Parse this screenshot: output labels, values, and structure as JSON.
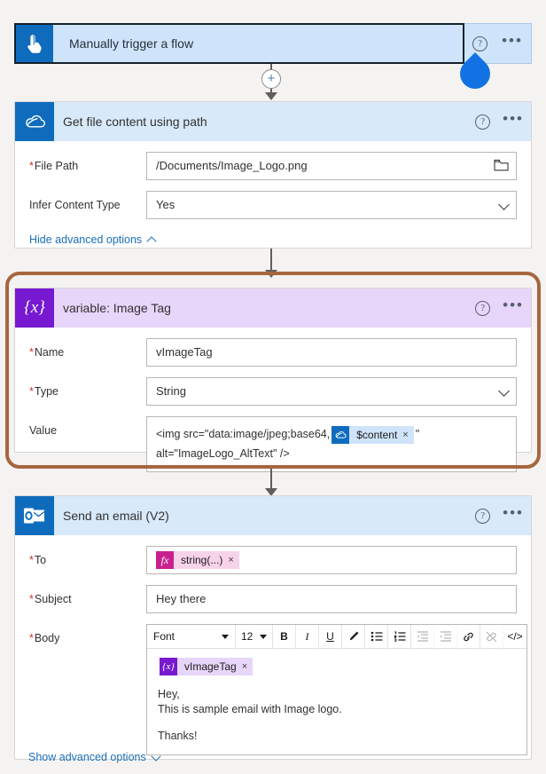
{
  "background_color": "#f4f3f2",
  "accent_color": "#0f6cbd",
  "highlight_border_color": "#a8653f",
  "cursor_color": "#1272e4",
  "trigger": {
    "icon": "tap-hand-icon",
    "title": "Manually trigger a flow",
    "help_label": "?",
    "menu_label": "•••"
  },
  "connector": {
    "plus_label": "+"
  },
  "get_file": {
    "icon": "onedrive-cloud-icon",
    "title": "Get file content using path",
    "help_label": "?",
    "menu_label": "•••",
    "fields": [
      {
        "label": "File Path",
        "required": true,
        "value": "/Documents/Image_Logo.png",
        "control": "textbox-with-folder-picker"
      },
      {
        "label": "Infer Content Type",
        "required": false,
        "value": "Yes",
        "control": "dropdown"
      }
    ],
    "advanced_link": "Hide advanced options"
  },
  "variable": {
    "icon": "variable-braces-icon",
    "icon_glyph": "{x}",
    "title": "variable: Image Tag",
    "help_label": "?",
    "menu_label": "•••",
    "name_label": "Name",
    "name_value": "vImageTag",
    "type_label": "Type",
    "type_value": "String",
    "value_label": "Value",
    "value_prefix": "<img src=\"data:image/jpeg;base64,",
    "value_token": {
      "icon": "onedrive-cloud-icon",
      "text": "$content",
      "remove_label": "×"
    },
    "value_suffix": "\"",
    "value_line2": "alt=\"ImageLogo_AltText\" />"
  },
  "email": {
    "icon": "outlook-icon",
    "title": "Send an email (V2)",
    "help_label": "?",
    "menu_label": "•••",
    "to_label": "To",
    "to_token": {
      "icon": "fx-expression-icon",
      "icon_glyph": "fx",
      "text": "string(...)",
      "remove_label": "×"
    },
    "subject_label": "Subject",
    "subject_value": "Hey there",
    "body_label": "Body",
    "toolbar": {
      "font_label": "Font",
      "size_label": "12",
      "bold_label": "B",
      "italic_label": "I",
      "underline_label": "U",
      "highlight_icon": "pen-highlight-icon",
      "bullet_list_icon": "bullet-list-icon",
      "numbered_list_icon": "numbered-list-icon",
      "indent_decrease_icon": "indent-decrease-icon",
      "indent_increase_icon": "indent-increase-icon",
      "link_icon": "link-icon",
      "unlink_icon": "unlink-icon",
      "code_label": "</>"
    },
    "body_token": {
      "icon": "variable-braces-icon",
      "icon_glyph": "{x}",
      "text": "vImageTag",
      "remove_label": "×"
    },
    "body_line1": "Hey,",
    "body_line2": "This is sample email with Image logo.",
    "body_line3": "Thanks!",
    "advanced_link": "Show advanced options"
  }
}
